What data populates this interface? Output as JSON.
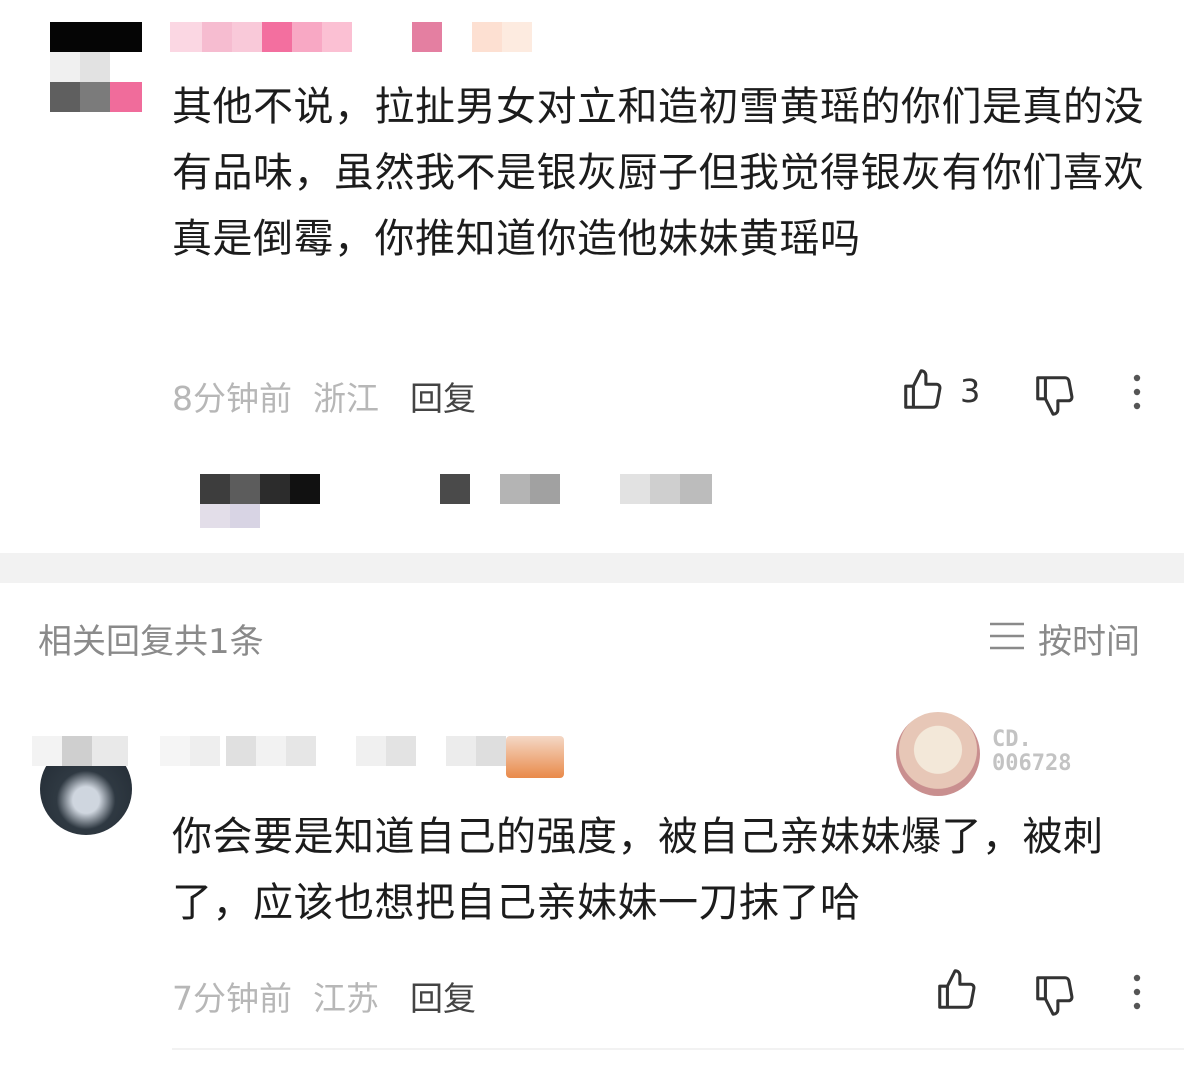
{
  "comment1": {
    "text": "其他不说，拉扯男女对立和造初雪黄瑶的你们是真的没有品味，虽然我不是银灰厨子但我觉得银灰有你们喜欢真是倒霉，你推知道你造他妹妹黄瑶吗",
    "time": "8分钟前",
    "location": "浙江",
    "reply_label": "回复",
    "like_count": "3"
  },
  "replies_section": {
    "title": "相关回复共1条",
    "sort_label": "按时间"
  },
  "reply1": {
    "text": "你会要是知道自己的强度，被自己亲妹妹爆了，被刺了，应该也想把自己亲妹妹一刀抹了哈",
    "time": "7分钟前",
    "location": "江苏",
    "reply_label": "回复",
    "badge_code": "CD.\n006728"
  },
  "icons": {
    "like": "thumbs-up-icon",
    "dislike": "thumbs-down-icon",
    "more": "more-vertical-icon",
    "sort": "sort-lines-icon"
  },
  "colors": {
    "meta_gray": "#b7b7b7",
    "band_gray": "#f2f2f2",
    "pink_accent": "#f27fa6"
  }
}
